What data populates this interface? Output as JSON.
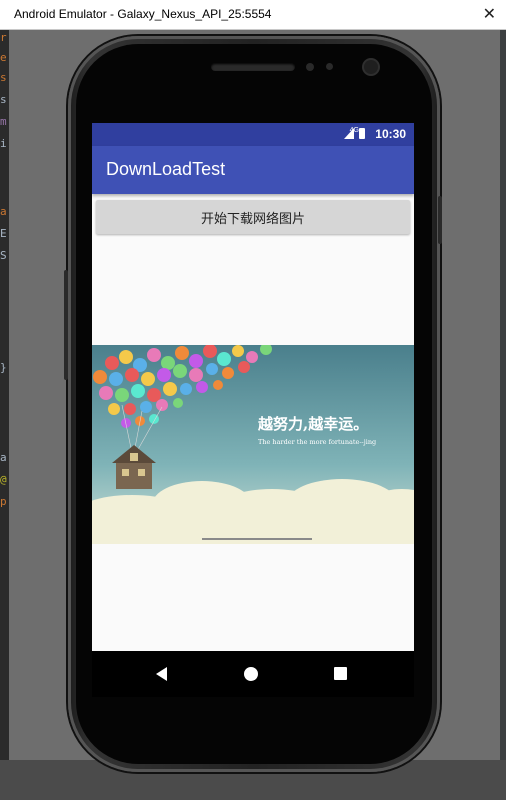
{
  "window": {
    "title": "Android Emulator - Galaxy_Nexus_API_25:5554",
    "close_glyph": "✕"
  },
  "statusbar": {
    "network": "4G",
    "time": "10:30"
  },
  "app": {
    "title": "DownLoadTest",
    "download_button_label": "开始下载网络图片"
  },
  "image": {
    "headline": "越努力,越幸运。",
    "subline": "The harder the more fortunate--jing"
  },
  "ide": {
    "left_glyphs": [
      "r",
      "e",
      "s",
      "s",
      "m",
      "i",
      "a",
      "E",
      "S",
      "}",
      "a",
      "@",
      "p"
    ]
  },
  "colors": {
    "status_bar": "#303f9f",
    "app_bar": "#3f51b5",
    "button": "#d6d6d6"
  }
}
